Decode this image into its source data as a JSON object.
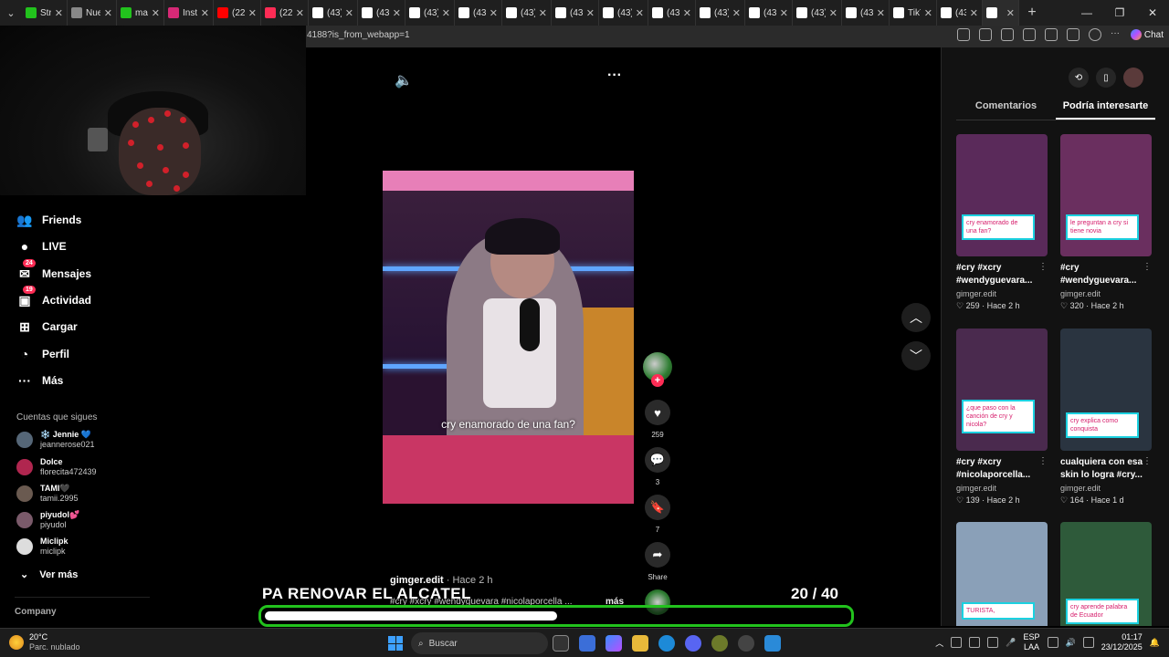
{
  "browser": {
    "tabs": [
      {
        "label": "Stre",
        "color": "#22c21d"
      },
      {
        "label": "Nue",
        "color": "#888888"
      },
      {
        "label": "mat",
        "color": "#22c21d"
      },
      {
        "label": "Insta",
        "color": "#d62976"
      },
      {
        "label": "(22)",
        "color": "#ff0000"
      },
      {
        "label": "(22)",
        "color": "#fe2c55"
      },
      {
        "label": "(43)",
        "color": "#ffffff"
      },
      {
        "label": "(43)",
        "color": "#ffffff"
      },
      {
        "label": "(43)",
        "color": "#ffffff"
      },
      {
        "label": "(43)",
        "color": "#ffffff"
      },
      {
        "label": "(43)",
        "color": "#ffffff"
      },
      {
        "label": "(43)",
        "color": "#ffffff"
      },
      {
        "label": "(43)",
        "color": "#ffffff"
      },
      {
        "label": "(43)",
        "color": "#ffffff"
      },
      {
        "label": "(43)",
        "color": "#ffffff"
      },
      {
        "label": "(43)",
        "color": "#ffffff"
      },
      {
        "label": "(43)",
        "color": "#ffffff"
      },
      {
        "label": "(43)",
        "color": "#ffffff"
      },
      {
        "label": "TikT",
        "color": "#ffffff"
      },
      {
        "label": "(43)",
        "color": "#ffffff"
      },
      {
        "label": "",
        "color": "#ffffff"
      }
    ],
    "url": "4188?is_from_webapp=1",
    "chat_label": "Chat"
  },
  "sidebar": {
    "items": [
      {
        "label": "Friends",
        "icon": "friends-icon"
      },
      {
        "label": "LIVE",
        "icon": "live-icon"
      },
      {
        "label": "Mensajes",
        "icon": "messages-icon",
        "badge": "24"
      },
      {
        "label": "Actividad",
        "icon": "activity-icon",
        "badge": "19"
      },
      {
        "label": "Cargar",
        "icon": "upload-icon"
      },
      {
        "label": "Perfil",
        "icon": "profile-icon"
      },
      {
        "label": "Más",
        "icon": "more-icon"
      }
    ],
    "following_title": "Cuentas que sigues",
    "following": [
      {
        "name": "❄️ Jennie 💙",
        "handle": "jeannerose021",
        "color": "#556677"
      },
      {
        "name": "Dolce",
        "handle": "florecita472439",
        "color": "#b0264f"
      },
      {
        "name": "TAMI🖤",
        "handle": "tamii.2995",
        "color": "#6a5a50"
      },
      {
        "name": "piyudol💕",
        "handle": "piyudol",
        "color": "#7a5a6a"
      },
      {
        "name": "Miclipk",
        "handle": "miclipk",
        "color": "#dddddd"
      }
    ],
    "see_more": "Ver más",
    "company": "Company"
  },
  "video": {
    "caption": "cry enamorado de una fan?",
    "likes": "259",
    "comments": "3",
    "saves": "7",
    "share_label": "Share",
    "author": "gimger.edit",
    "time": "· Hace 2 h",
    "tags": "#cry #xcry #wendyguevara #nicolaporcella ...",
    "more_label": "más"
  },
  "overlay": {
    "title": "PA RENOVAR EL ALCATEL",
    "current": "20",
    "total": "/ 40",
    "progress": 0.5
  },
  "rightpanel": {
    "tabs": [
      "Comentarios",
      "Podría interesarte"
    ],
    "cards": [
      {
        "title": "#cry #xcry #wendyguevara...",
        "author": "gimger.edit",
        "stats": "♡ 259 · Hace 2 h",
        "cap": "cry enamorado de una fan?",
        "bg": "#5a2a5a"
      },
      {
        "title": "#cry #wendyguevara...",
        "author": "gimger.edit",
        "stats": "♡ 320 · Hace 2 h",
        "cap": "le preguntan a cry si tiene novia",
        "bg": "#6a2f5f"
      },
      {
        "title": "#cry #xcry #nicolaporcella...",
        "author": "gimger.edit",
        "stats": "♡ 139 · Hace 2 h",
        "cap": "¿que paso con la canción de cry y nicola?",
        "bg": "#4a2a4e"
      },
      {
        "title": "cualquiera con esa skin lo logra #cry...",
        "author": "gimger.edit",
        "stats": "♡ 164 · Hace 1 d",
        "cap": "cry explica como conquista",
        "bg": "#2a3440"
      },
      {
        "title": "",
        "author": "",
        "stats": "",
        "cap": "TURISTA,",
        "bg": "#8aa0b8"
      },
      {
        "title": "",
        "author": "",
        "stats": "",
        "cap": "cry aprende palabra de Ecuador",
        "bg": "#2e5a3a"
      }
    ]
  },
  "taskbar": {
    "temp": "20°C",
    "weather": "Parc. nublado",
    "search": "Buscar",
    "lang1": "ESP",
    "lang2": "LAA",
    "time": "01:17",
    "date": "23/12/2025"
  }
}
